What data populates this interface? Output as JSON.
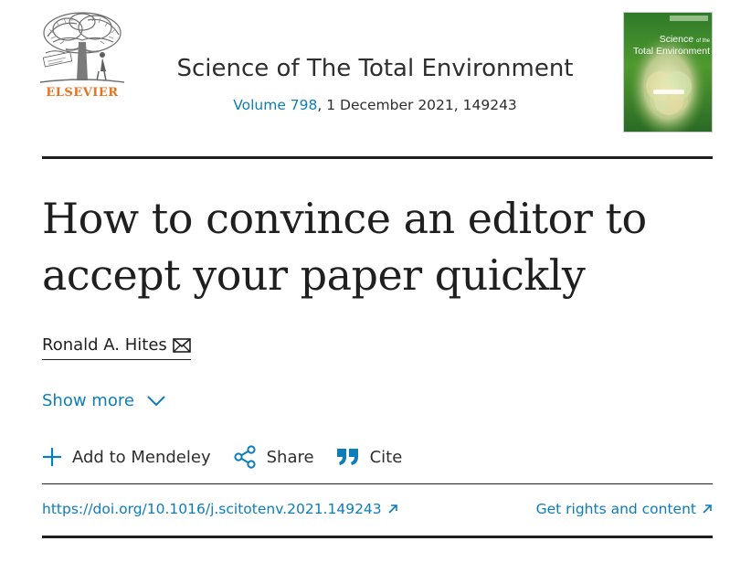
{
  "header": {
    "publisher_logo_text": "ELSEVIER",
    "journal_title": "Science of The Total Environment",
    "volume_link": "Volume 798",
    "issue_details": ", 1 December 2021, 149243",
    "cover_title_line1": "Science",
    "cover_title_of_the": "of the",
    "cover_title_line2": "Total Environment"
  },
  "article": {
    "title": "How to convince an editor to accept your paper quickly",
    "author": "Ronald A. Hites",
    "show_more_label": "Show more"
  },
  "actions": {
    "mendeley_label": "Add to Mendeley",
    "share_label": "Share",
    "cite_label": "Cite"
  },
  "links": {
    "doi": "https://doi.org/10.1016/j.scitotenv.2021.149243",
    "rights": "Get rights and content"
  },
  "colors": {
    "link_blue": "#0c7dbb",
    "elsevier_orange": "#e9711c",
    "text_dark": "#1f1f1f"
  },
  "icons": {
    "author_contact": "envelope-icon",
    "show_more": "chevron-down-icon",
    "mendeley": "plus-icon",
    "share": "share-icon",
    "cite": "quote-icon",
    "external": "arrow-up-right-icon"
  }
}
